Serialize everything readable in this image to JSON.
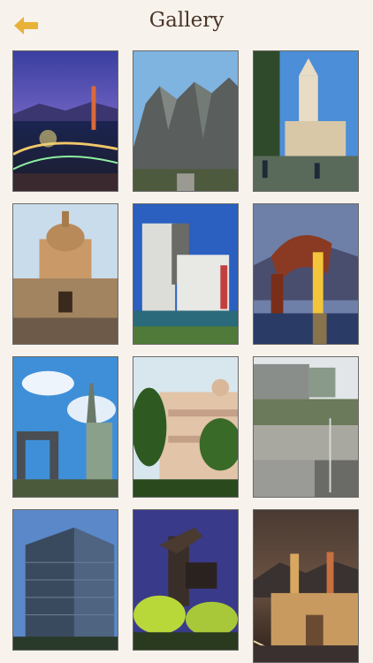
{
  "header": {
    "title": "Gallery",
    "back_icon": "back-arrow-icon",
    "accent_color": "#e8b23a"
  },
  "gallery": {
    "columns": 3,
    "item_count": 12
  }
}
